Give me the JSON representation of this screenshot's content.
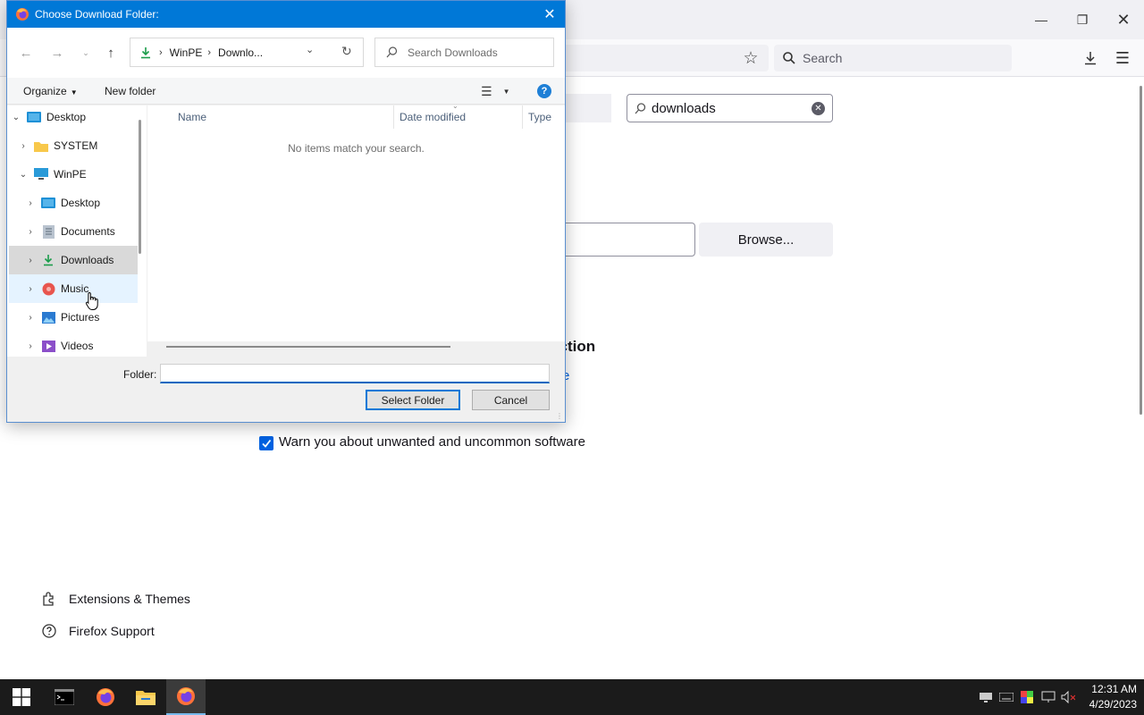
{
  "firefox": {
    "search_placeholder": "Search",
    "settings_search_value": "downloads",
    "browse_label": "Browse...",
    "section_heading_fragment": "otection",
    "learn_more_fragment": "e",
    "warn_label": "Warn you about unwanted and uncommon software",
    "warn_checked": true,
    "sidebar_links": [
      {
        "label": "Extensions & Themes",
        "icon": "puzzle-icon"
      },
      {
        "label": "Firefox Support",
        "icon": "help-circle-icon"
      }
    ]
  },
  "dialog": {
    "title": "Choose Download Folder:",
    "address": {
      "segments": [
        "WinPE",
        "Downlo..."
      ],
      "icon": "download-arrow-icon"
    },
    "search_placeholder": "Search Downloads",
    "toolbar": {
      "organize": "Organize",
      "new_folder": "New folder"
    },
    "tree": [
      {
        "label": "Desktop",
        "icon": "desktop-icon",
        "expanded": true
      },
      {
        "label": "SYSTEM",
        "icon": "folder-icon",
        "expanded": false
      },
      {
        "label": "WinPE",
        "icon": "computer-icon",
        "expanded": true
      },
      {
        "label": "Desktop",
        "icon": "desktop-icon",
        "expanded": false
      },
      {
        "label": "Documents",
        "icon": "documents-icon",
        "expanded": false
      },
      {
        "label": "Downloads",
        "icon": "downloads-icon",
        "expanded": false,
        "selected": true
      },
      {
        "label": "Music",
        "icon": "music-icon",
        "expanded": false,
        "hover": true
      },
      {
        "label": "Pictures",
        "icon": "pictures-icon",
        "expanded": false
      },
      {
        "label": "Videos",
        "icon": "videos-icon",
        "expanded": false
      }
    ],
    "columns": [
      "Name",
      "Date modified",
      "Type"
    ],
    "empty_message": "No items match your search.",
    "folder_label": "Folder:",
    "folder_value": "",
    "select_button": "Select Folder",
    "cancel_button": "Cancel"
  },
  "taskbar": {
    "time": "12:31 AM",
    "date": "4/29/2023"
  },
  "colors": {
    "accent": "#0078d7",
    "firefox_blue": "#0061e0",
    "taskbar": "#1b1b1b"
  }
}
